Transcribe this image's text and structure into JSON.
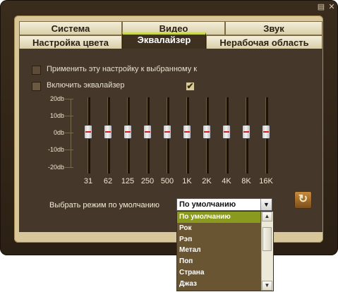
{
  "window": {
    "menu_icon": "menu-icon",
    "close_icon": "close-icon"
  },
  "tabs": {
    "row1": [
      {
        "label": "Система"
      },
      {
        "label": "Видео"
      },
      {
        "label": "Звук"
      }
    ],
    "row2": [
      {
        "label": "Настройка цвета"
      },
      {
        "label": "Эквалайзер",
        "active": true
      },
      {
        "label": "Нерабочая область"
      }
    ]
  },
  "options": {
    "apply_label": "Применить эту настройку к выбранному к",
    "apply_checked": false,
    "enable_label": "Включить эквалайзер",
    "enable_checked": true
  },
  "equalizer": {
    "db_labels": [
      "20db",
      "10db",
      "0db",
      "-10db",
      "-20db"
    ],
    "bands": [
      {
        "freq": "31",
        "gain_db": 0
      },
      {
        "freq": "62",
        "gain_db": 0
      },
      {
        "freq": "125",
        "gain_db": 0
      },
      {
        "freq": "250",
        "gain_db": 0
      },
      {
        "freq": "500",
        "gain_db": 0
      },
      {
        "freq": "1K",
        "gain_db": 0
      },
      {
        "freq": "2K",
        "gain_db": 0
      },
      {
        "freq": "4K",
        "gain_db": 0
      },
      {
        "freq": "8K",
        "gain_db": 0
      },
      {
        "freq": "16K",
        "gain_db": 0
      }
    ]
  },
  "preset": {
    "label": "Выбрать режим по умолчанию",
    "selected": "По умолчанию",
    "options": [
      "По умолчанию",
      "Рок",
      "Рэп",
      "Метал",
      "Поп",
      "Страна",
      "Джаз"
    ]
  },
  "colors": {
    "frame": "#2b2014",
    "tab_active_accent": "#c9d84a",
    "content_bg": "#45382a",
    "selected_option": "#8a9a1f"
  }
}
